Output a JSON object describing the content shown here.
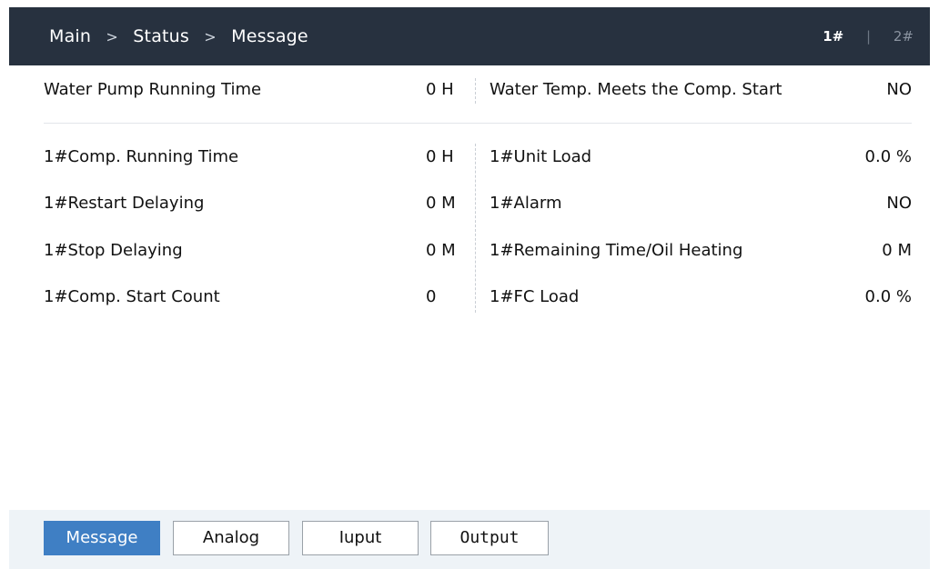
{
  "header": {
    "breadcrumb": [
      "Main",
      "Status",
      "Message"
    ],
    "separator": ">",
    "unit_tabs": [
      {
        "label": "1#",
        "active": true
      },
      {
        "label": "2#",
        "active": false
      }
    ],
    "tab_divider": "|"
  },
  "rows": [
    {
      "left_label": "Water Pump Running Time",
      "left_value": "0 H",
      "right_label": "Water Temp. Meets the Comp. Start",
      "right_value": "NO"
    },
    {
      "left_label": "1#Comp. Running Time",
      "left_value": "0 H",
      "right_label": "1#Unit Load",
      "right_value": "0.0 %"
    },
    {
      "left_label": "1#Restart Delaying",
      "left_value": "0 M",
      "right_label": "1#Alarm",
      "right_value": "NO"
    },
    {
      "left_label": "1#Stop Delaying",
      "left_value": "0 M",
      "right_label": "1#Remaining Time/Oil Heating",
      "right_value": "0 M"
    },
    {
      "left_label": "1#Comp. Start Count",
      "left_value": "0",
      "right_label": "1#FC Load",
      "right_value": "0.0 %"
    }
  ],
  "footer": {
    "buttons": [
      {
        "label": "Message",
        "active": true
      },
      {
        "label": "Analog",
        "active": false
      },
      {
        "label": "Iuput",
        "active": false
      },
      {
        "label": "Output",
        "active": false
      }
    ]
  },
  "colors": {
    "header_bg": "#27313f",
    "active_button": "#3f7fc4",
    "footer_bg": "#eef3f7"
  }
}
